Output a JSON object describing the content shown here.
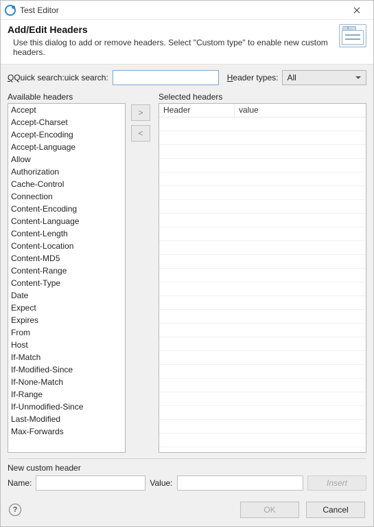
{
  "window": {
    "title": "Test Editor"
  },
  "header": {
    "heading": "Add/Edit Headers",
    "subtext": "Use this dialog to add or remove headers. Select \"Custom type\" to enable new custom headers."
  },
  "filters": {
    "quick_search_label": "Quick search:",
    "quick_search_value": "",
    "header_types_label": "Header types:",
    "header_types_value": "All"
  },
  "labels": {
    "available": "Available headers",
    "selected": "Selected headers",
    "move_right": ">",
    "move_left": "<",
    "sel_col_header": "Header",
    "sel_col_value": "value"
  },
  "available_headers": [
    "Accept",
    "Accept-Charset",
    "Accept-Encoding",
    "Accept-Language",
    "Allow",
    "Authorization",
    "Cache-Control",
    "Connection",
    "Content-Encoding",
    "Content-Language",
    "Content-Length",
    "Content-Location",
    "Content-MD5",
    "Content-Range",
    "Content-Type",
    "Date",
    "Expect",
    "Expires",
    "From",
    "Host",
    "If-Match",
    "If-Modified-Since",
    "If-None-Match",
    "If-Range",
    "If-Unmodified-Since",
    "Last-Modified",
    "Max-Forwards"
  ],
  "selected_headers": [],
  "custom": {
    "group_label": "New custom header",
    "name_label": "Name:",
    "name_value": "",
    "value_label": "Value:",
    "value_value": "",
    "insert_label": "Insert"
  },
  "buttons": {
    "ok": "OK",
    "cancel": "Cancel",
    "help": "?"
  }
}
